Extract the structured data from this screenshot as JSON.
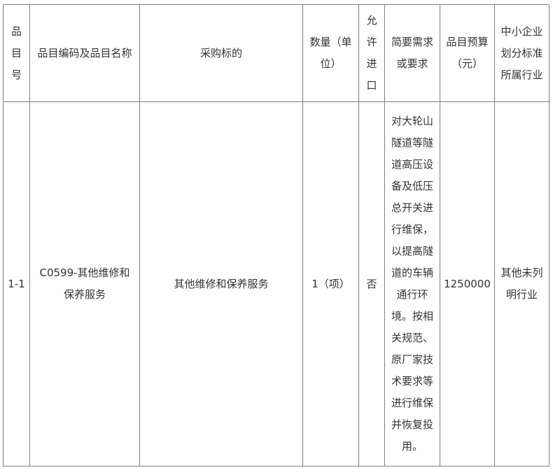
{
  "table": {
    "headers": {
      "item_no": "品目号",
      "item_code_name": "品目编码及品目名称",
      "target": "采购标的",
      "quantity": "数量（单位）",
      "import_allowed": "允许进口",
      "requirements": "简要需求或要求",
      "budget": "品目预算（元）",
      "industry": "中小企业划分标准所属行业"
    },
    "rows": [
      {
        "item_no": "1-1",
        "item_code_name": "C0599-其他维修和保养服务",
        "target": "其他维修和保养服务",
        "quantity": "1（项）",
        "import_allowed": "否",
        "requirements": "对大轮山隧道等隧道高压设备及低压总开关进行维保，以提高隧道的车辆通行环境。按相关规范、原厂家技术要求等进行维保并恢复投用。",
        "budget": "1250000",
        "industry": "其他未列明行业"
      }
    ]
  }
}
